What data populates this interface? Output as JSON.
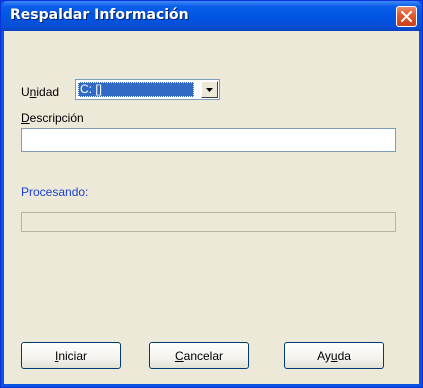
{
  "window": {
    "title": "Respaldar Información"
  },
  "form": {
    "unidad_label": "Unidad",
    "unidad_value": "C: []",
    "descripcion_label": "Descripción",
    "descripcion_value": "",
    "procesando_label": "Procesando:",
    "progress_fraction": 0
  },
  "buttons": {
    "iniciar": "Iniciar",
    "cancelar": "Cancelar",
    "ayuda": "Ayuda"
  },
  "icons": {
    "close": "close-icon",
    "dropdown": "chevron-down-icon"
  },
  "colors": {
    "titlebar": "#0054e3",
    "close_button": "#e0582b",
    "dialog_bg": "#ece9d8",
    "selection": "#316ac5",
    "procesando_text": "#1a3fd1"
  }
}
